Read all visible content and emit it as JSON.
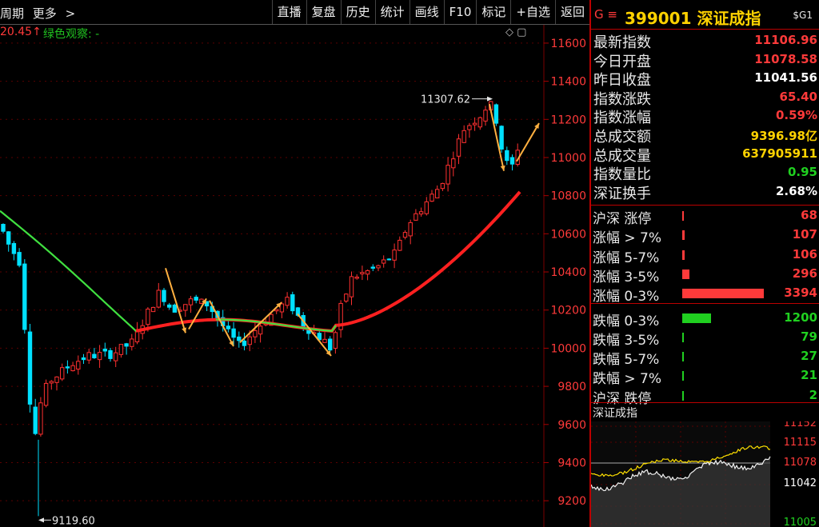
{
  "topbar": {
    "left_items": [
      "周期",
      "更多",
      ">"
    ],
    "buttons": [
      "直播",
      "复盘",
      "历史",
      "统计",
      "画线",
      "F10",
      "标记",
      "+自选",
      "返回"
    ]
  },
  "subheader": {
    "left_text": "20.45↑",
    "green_text": "绿色观察: -",
    "icons": "◇ ▢"
  },
  "chart": {
    "y_ticks": [
      "11600",
      "11400",
      "11200",
      "11000",
      "10800",
      "10600",
      "10400",
      "10200",
      "10000",
      "9800",
      "9600",
      "9400",
      "9200"
    ],
    "high_annotation": "11307.62",
    "low_annotation": "9119.60"
  },
  "chart_data": {
    "type": "candlestick",
    "y_range": [
      9100,
      11650
    ],
    "ma_color": "#ff2020",
    "ma_old_color": "#40e040",
    "up_color": "#ff3030",
    "down_color": "#00e0ff",
    "high": 11307.62,
    "low": 9119.6
  },
  "quote": {
    "prefix": "G ≡",
    "code_name": "399001 深证成指",
    "tag": "$G1",
    "rows": [
      {
        "label": "最新指数",
        "value": "11106.96",
        "color": "#ff3a3a"
      },
      {
        "label": "今日开盘",
        "value": "11078.58",
        "color": "#ff3a3a"
      },
      {
        "label": "昨日收盘",
        "value": "11041.56",
        "color": "#ffffff"
      },
      {
        "label": "指数涨跌",
        "value": "65.40",
        "color": "#ff3a3a"
      },
      {
        "label": "指数涨幅",
        "value": "0.59%",
        "color": "#ff3a3a"
      },
      {
        "label": "总成交额",
        "value": "9396.98亿",
        "color": "#ffd200"
      },
      {
        "label": "总成交量",
        "value": "637905911",
        "color": "#ffd200"
      },
      {
        "label": "指数量比",
        "value": "0.95",
        "color": "#20d020"
      },
      {
        "label": "深证换手",
        "value": "2.68%",
        "color": "#ffffff"
      }
    ]
  },
  "breadth": [
    {
      "label": "沪深 涨停",
      "value": "68",
      "count": 68,
      "color": "#ff3a3a"
    },
    {
      "label": "涨幅 > 7%",
      "value": "107",
      "count": 107,
      "color": "#ff3a3a"
    },
    {
      "label": "涨幅 5-7%",
      "value": "106",
      "count": 106,
      "color": "#ff3a3a"
    },
    {
      "label": "涨幅 3-5%",
      "value": "296",
      "count": 296,
      "color": "#ff3a3a"
    },
    {
      "label": "涨幅 0-3%",
      "value": "3394",
      "count": 3394,
      "color": "#ff3a3a"
    },
    {
      "label": "跌幅 0-3%",
      "value": "1200",
      "count": 1200,
      "color": "#20d020"
    },
    {
      "label": "跌幅 3-5%",
      "value": "79",
      "count": 79,
      "color": "#20d020"
    },
    {
      "label": "跌幅 5-7%",
      "value": "27",
      "count": 27,
      "color": "#20d020"
    },
    {
      "label": "跌幅 > 7%",
      "value": "21",
      "count": 21,
      "color": "#20d020"
    },
    {
      "label": "沪深 跌停",
      "value": "2",
      "count": 2,
      "color": "#20d020"
    }
  ],
  "mini_chart": {
    "title": "深证成指",
    "ticks": [
      "11152",
      "11115",
      "11078",
      "11042",
      "11005"
    ]
  }
}
